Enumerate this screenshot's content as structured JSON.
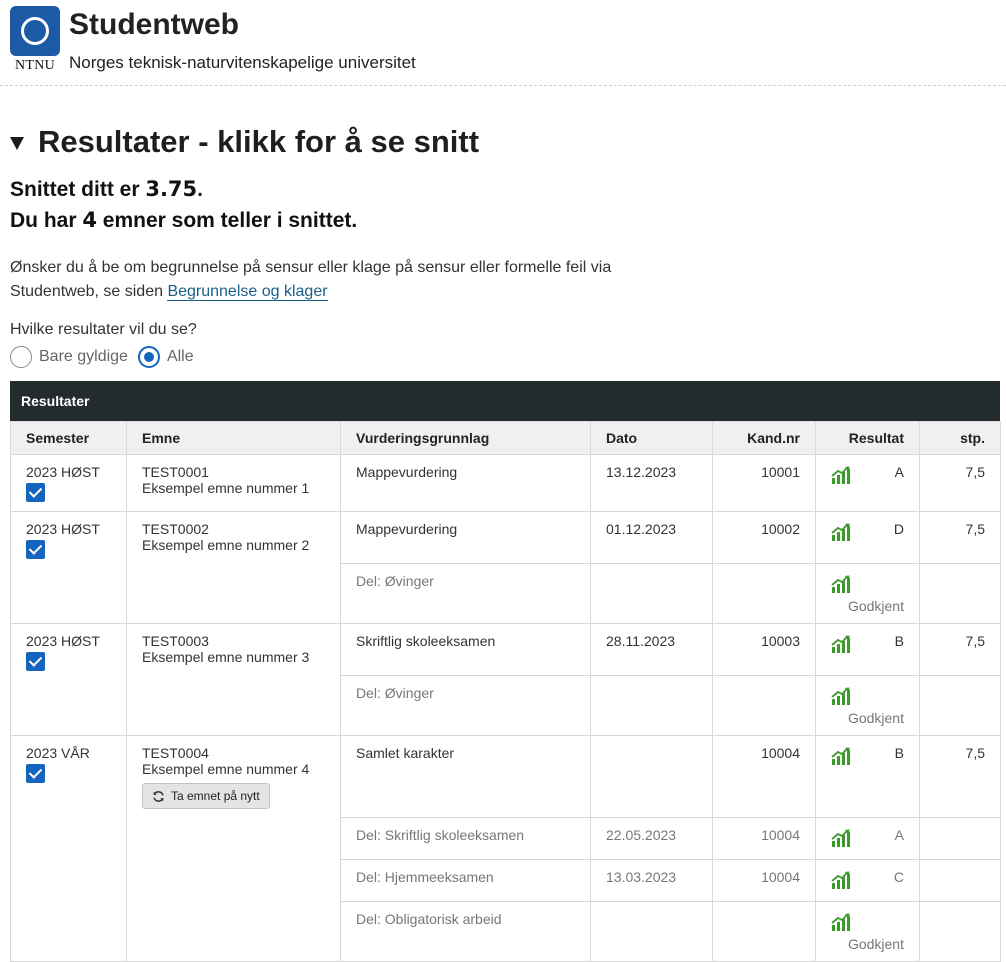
{
  "header": {
    "logo_text": "NTNU",
    "title": "Studentweb",
    "subtitle": "Norges teknisk-naturvitenskapelige universitet"
  },
  "section": {
    "title": "Resultater - klikk for å se snitt"
  },
  "average": {
    "line1_prefix": "Snittet ditt er ",
    "value": "3.75",
    "line1_suffix": ".",
    "line2_prefix": "Du har ",
    "count": "4",
    "line2_suffix": " emner som teller i snittet."
  },
  "info": {
    "text": "Ønsker du å be om begrunnelse på sensur eller klage på sensur eller formelle feil via Studentweb, se siden ",
    "link": "Begrunnelse og klager"
  },
  "filter": {
    "question": "Hvilke resultater vil du se?",
    "options": [
      "Bare gyldige",
      "Alle"
    ],
    "selected": "Alle"
  },
  "table": {
    "caption": "Resultater",
    "columns": [
      "Semester",
      "Emne",
      "Vurderingsgrunnlag",
      "Dato",
      "Kand.nr",
      "Resultat",
      "stp."
    ],
    "retake_label": "Ta emnet på nytt",
    "rows": [
      {
        "semester": "2023 HØST",
        "code": "TEST0001",
        "name": "Eksempel emne nummer 1",
        "basis": "Mappevurdering",
        "date": "13.12.2023",
        "cand": "10001",
        "result": "A",
        "credits": "7,5"
      },
      {
        "semester": "2023 HØST",
        "code": "TEST0002",
        "name": "Eksempel emne nummer 2",
        "basis": "Mappevurdering",
        "date": "01.12.2023",
        "cand": "10002",
        "result": "D",
        "credits": "7,5"
      },
      {
        "basis": "Del: Øvinger",
        "date": "",
        "cand": "",
        "result": "Godkjent",
        "credits": ""
      },
      {
        "semester": "2023 HØST",
        "code": "TEST0003",
        "name": "Eksempel emne nummer 3",
        "basis": "Skriftlig skoleeksamen",
        "date": "28.11.2023",
        "cand": "10003",
        "result": "B",
        "credits": "7,5"
      },
      {
        "basis": "Del: Øvinger",
        "date": "",
        "cand": "",
        "result": "Godkjent",
        "credits": ""
      },
      {
        "semester": "2023 VÅR",
        "code": "TEST0004",
        "name": "Eksempel emne nummer 4",
        "basis": "Samlet karakter",
        "date": "",
        "cand": "10004",
        "result": "B",
        "credits": "7,5"
      },
      {
        "basis": "Del: Skriftlig skoleeksamen",
        "date": "22.05.2023",
        "cand": "10004",
        "result": "A",
        "credits": ""
      },
      {
        "basis": "Del: Hjemmeeksamen",
        "date": "13.03.2023",
        "cand": "10004",
        "result": "C",
        "credits": ""
      },
      {
        "basis": "Del: Obligatorisk arbeid",
        "date": "",
        "cand": "",
        "result": "Godkjent",
        "credits": ""
      }
    ]
  },
  "colors": {
    "brand_blue": "#1c5aa6",
    "caption_bg": "#242b2e",
    "accent_blue": "#1565c0",
    "chart_green": "#3a9a2a",
    "link": "#1a5f8a"
  }
}
